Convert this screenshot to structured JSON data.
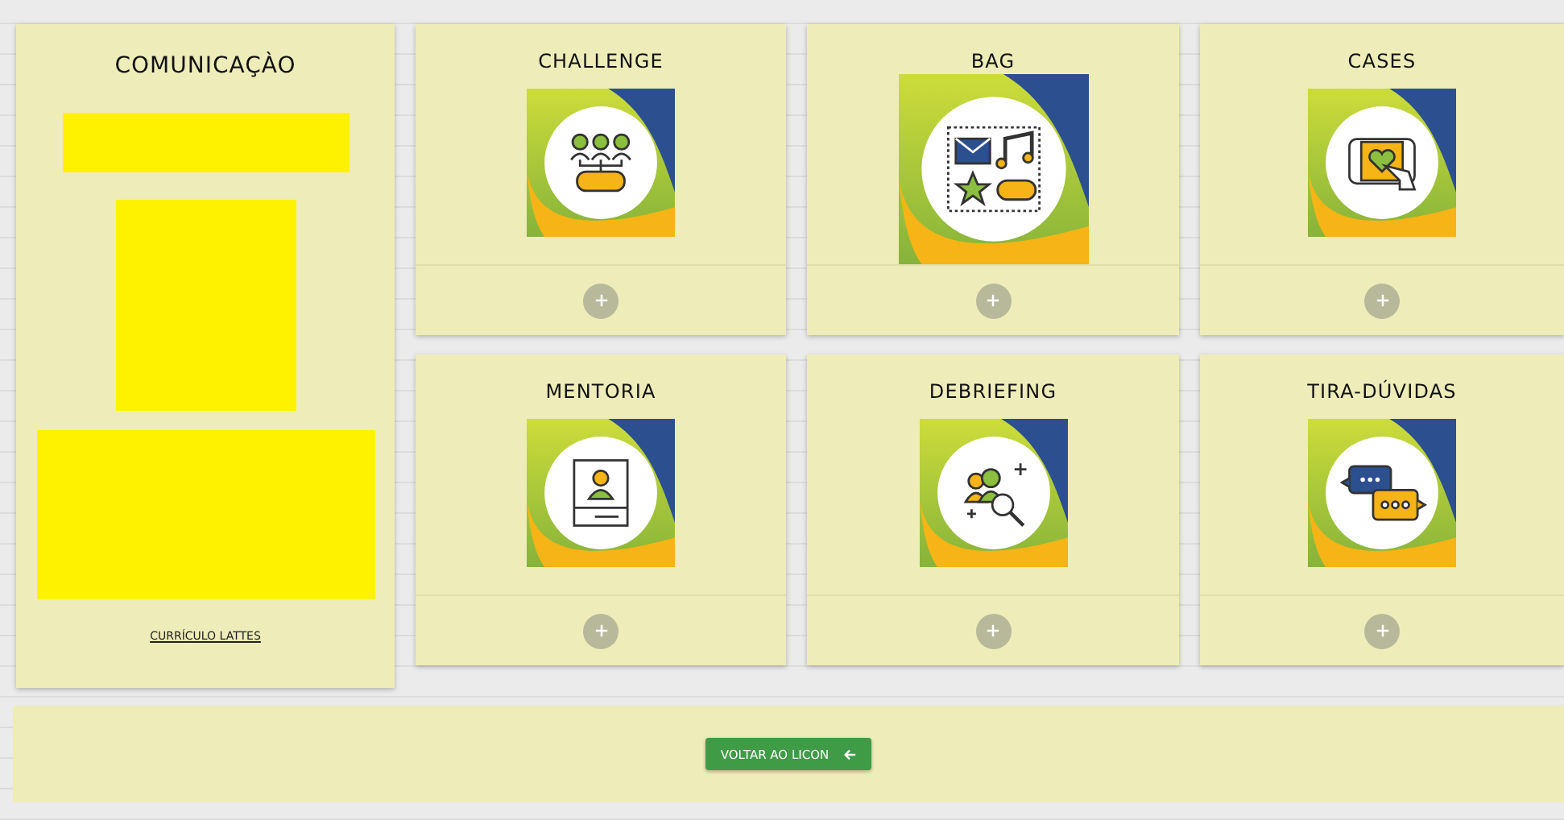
{
  "left_panel": {
    "title": "COMUNICAÇÀO",
    "link": "CURRÍCULO LATTES"
  },
  "cards": [
    {
      "title": "CHALLENGE"
    },
    {
      "title": "BAG"
    },
    {
      "title": "CASES"
    },
    {
      "title": "MENTORIA"
    },
    {
      "title": "DEBRIEFING"
    },
    {
      "title": "TIRA-DÚVIDAS"
    }
  ],
  "footer": {
    "button": "VOLTAR AO LICON"
  }
}
